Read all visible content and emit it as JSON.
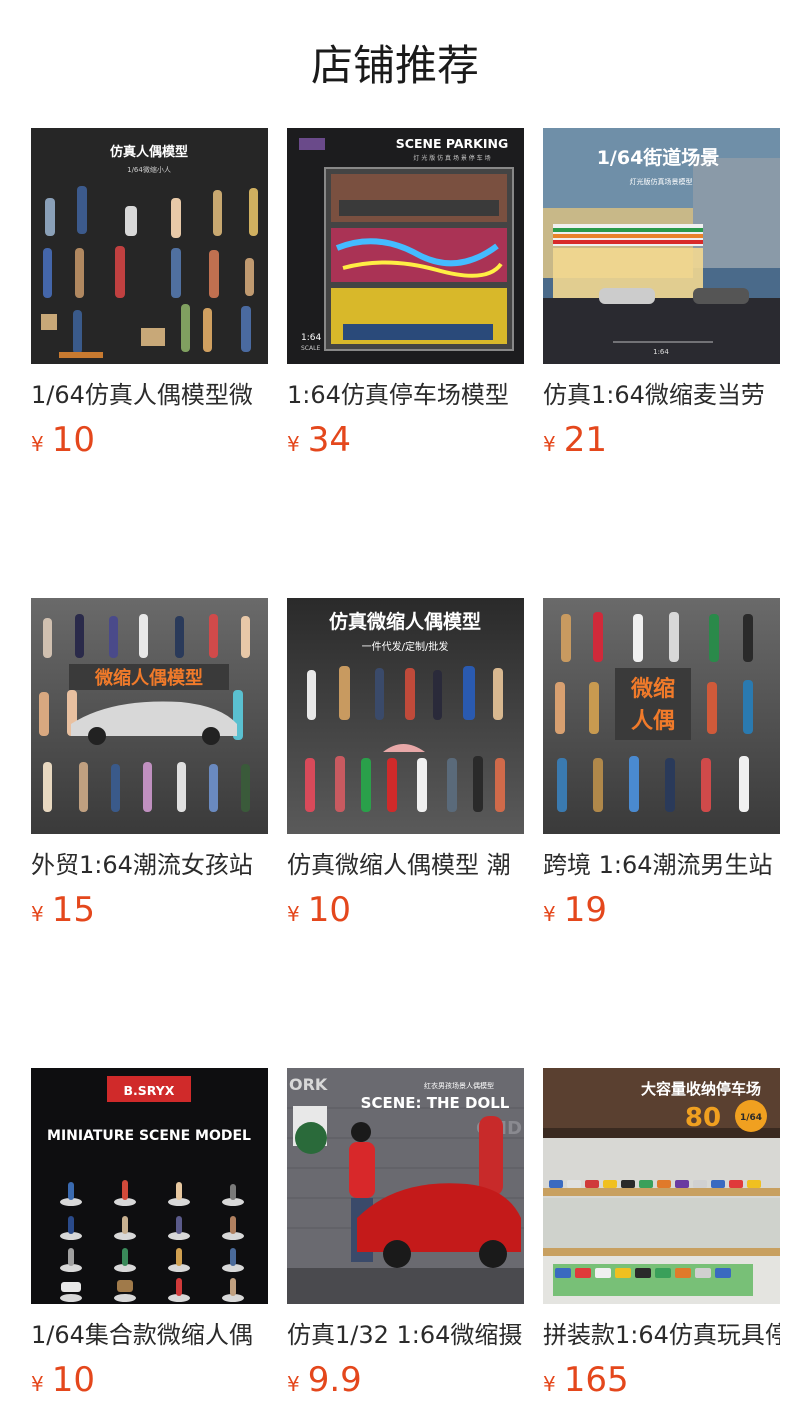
{
  "page": {
    "title": "店铺推荐"
  },
  "currency_symbol": "¥",
  "products": [
    {
      "name": "1/64仿真人偶模型微",
      "price": "10",
      "image": {
        "headline": "仿真人偶模型",
        "sub": "1/64微缩小人"
      }
    },
    {
      "name": "1:64仿真停车场模型",
      "price": "34",
      "image": {
        "headline": "SCENE PARKING",
        "sub": "灯 光 版 仿 真 场 景 停 车 场",
        "scale": "1:64",
        "scale_sub": "SCALE"
      }
    },
    {
      "name": "仿真1:64微缩麦当劳",
      "price": "21",
      "image": {
        "headline": "1/64街道场景",
        "sub": "灯光版仿真场景模型",
        "scale": "1:64"
      }
    },
    {
      "name": "外贸1:64潮流女孩站",
      "price": "15",
      "image": {
        "headline": "微缩人偶模型"
      }
    },
    {
      "name": "仿真微缩人偶模型 潮",
      "price": "10",
      "image": {
        "headline": "仿真微缩人偶模型",
        "sub": "一件代发/定制/批发"
      }
    },
    {
      "name": "跨境 1:64潮流男生站",
      "price": "19",
      "image": {
        "headline": "微缩",
        "headline2": "人偶"
      }
    },
    {
      "name": "1/64集合款微缩人偶",
      "price": "10",
      "image": {
        "badge": "B.SRYX",
        "headline": "MINIATURE SCENE MODEL"
      }
    },
    {
      "name": "仿真1/32 1:64微缩摄",
      "price": "9.9",
      "image": {
        "corner": "ORK",
        "sub": "红衣男孩场景人偶模型",
        "headline": "SCENE: THE DOLL",
        "wall": "CMD"
      }
    },
    {
      "name": "拼装款1:64仿真玩具停",
      "price": "165",
      "image": {
        "headline": "大容量收纳停车场",
        "big": "80",
        "scale": "1/64"
      }
    }
  ],
  "colors": {
    "price": "#e4471c",
    "title": "#1a1a1a",
    "name": "#2b2b2b"
  }
}
